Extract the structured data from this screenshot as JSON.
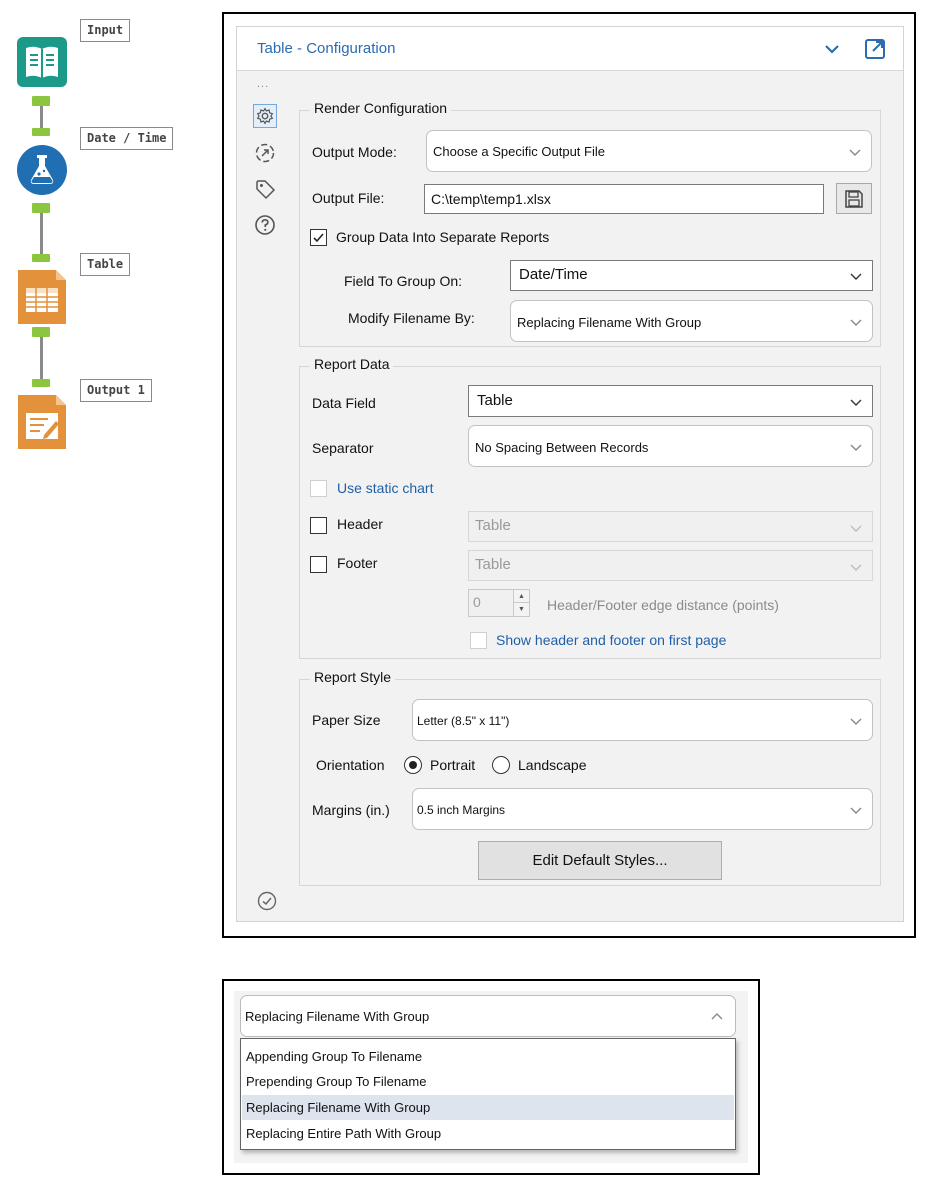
{
  "workflow": {
    "tools": [
      {
        "label": "Input",
        "icon": "input-data-icon",
        "color": "#1b9a8a"
      },
      {
        "label": "Date / Time",
        "icon": "datetime-tool-icon",
        "color": "#1f6fb2"
      },
      {
        "label": "Table",
        "icon": "table-tool-icon",
        "color": "#e3913a"
      },
      {
        "label": "Output 1",
        "icon": "render-output-icon",
        "color": "#e3913a"
      }
    ]
  },
  "config": {
    "title": "Table - Configuration",
    "side_dots": "...",
    "render": {
      "group_title": "Render Configuration",
      "output_mode_label": "Output Mode:",
      "output_mode_value": "Choose a Specific Output File",
      "output_file_label": "Output File:",
      "output_file_value": "C:\\temp\\temp1.xlsx",
      "group_data_label": "Group Data Into Separate Reports",
      "group_data_checked": true,
      "field_to_group_label": "Field To Group On:",
      "field_to_group_value": "Date/Time",
      "modify_filename_label": "Modify Filename By:",
      "modify_filename_value": "Replacing Filename With Group"
    },
    "report_data": {
      "group_title": "Report Data",
      "data_field_label": "Data Field",
      "data_field_value": "Table",
      "separator_label": "Separator",
      "separator_value": "No Spacing Between Records",
      "static_chart_label": "Use static chart",
      "header_label": "Header",
      "header_value": "Table",
      "footer_label": "Footer",
      "footer_value": "Table",
      "edge_distance_value": "0",
      "edge_distance_label": "Header/Footer edge distance (points)",
      "show_first_page_label": "Show header and footer on first page"
    },
    "report_style": {
      "group_title": "Report Style",
      "paper_size_label": "Paper Size",
      "paper_size_value": "Letter (8.5\" x 11\")",
      "orientation_label": "Orientation",
      "portrait_label": "Portrait",
      "landscape_label": "Landscape",
      "orientation_selected": "Portrait",
      "margins_label": "Margins (in.)",
      "margins_value": "0.5 inch Margins",
      "edit_styles_label": "Edit Default Styles..."
    }
  },
  "dropdown_detail": {
    "selected_value": "Replacing Filename With Group",
    "options": [
      "Appending Group To Filename",
      "Prepending Group To Filename",
      "Replacing Filename With Group",
      "Replacing Entire Path With Group"
    ],
    "highlighted_index": 2
  },
  "colors": {
    "accent_blue": "#2b6cb0",
    "anchor_green": "#8cc63f",
    "tool_teal": "#1b9a8a",
    "tool_blue": "#1f6fb2",
    "tool_orange": "#e3913a"
  }
}
